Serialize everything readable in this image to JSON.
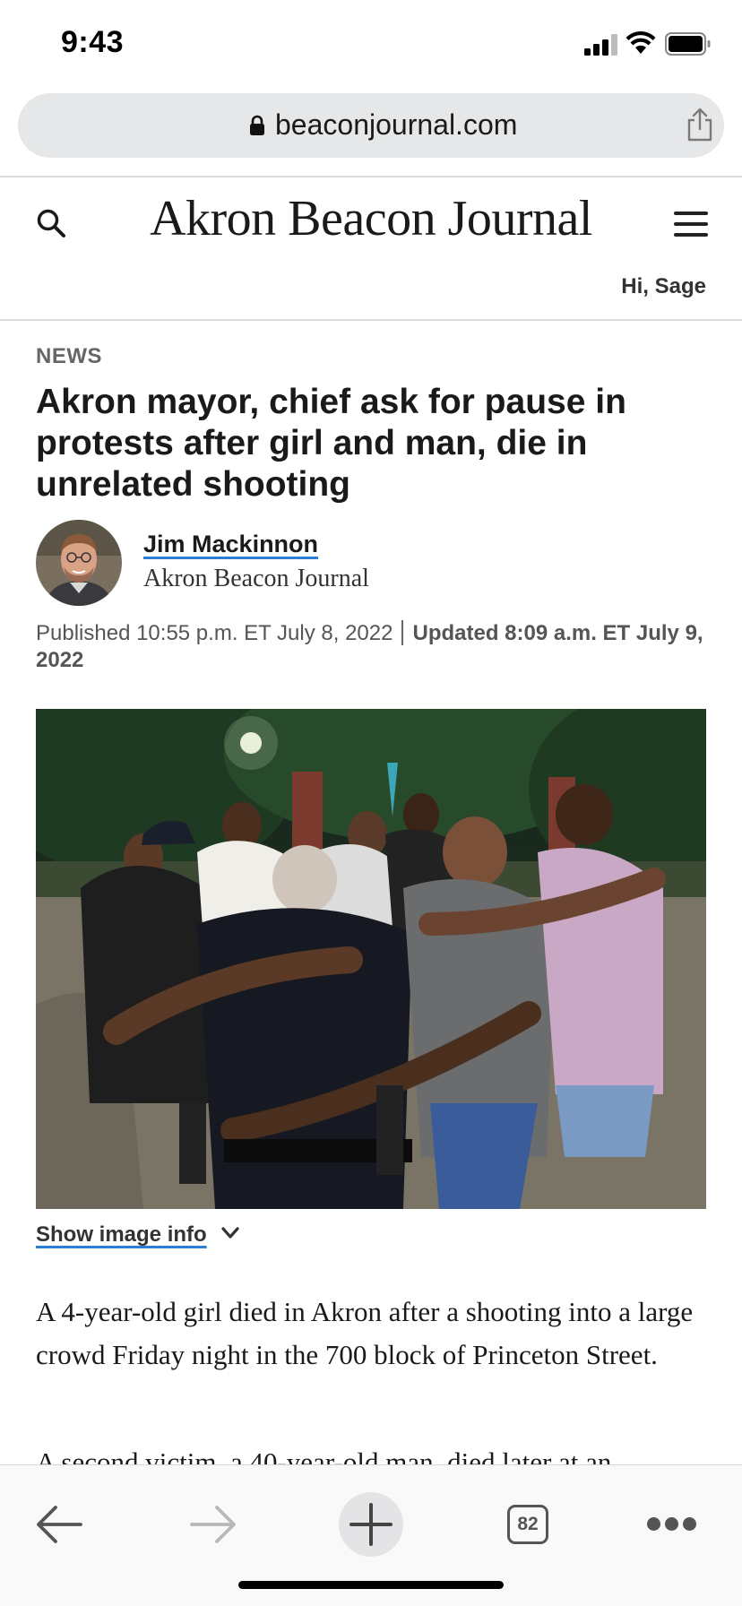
{
  "status_bar": {
    "time": "9:43"
  },
  "browser": {
    "url": "beaconjournal.com"
  },
  "site": {
    "logo": "Akron Beacon Journal",
    "greeting": "Hi, Sage"
  },
  "article": {
    "section": "NEWS",
    "headline": "Akron mayor, chief ask for pause in protests after girl and man, die in unrelated shooting",
    "author": {
      "name": "Jim Mackinnon",
      "outlet": "Akron Beacon Journal"
    },
    "published": "Published 10:55 p.m. ET July 8, 2022",
    "updated": "Updated 8:09 a.m. ET July 9, 2022",
    "image_info_label": "Show image info",
    "paragraphs": [
      "A 4-year-old girl died in Akron after a shooting into a large crowd Friday night in the 700 block of Princeton Street.",
      "A second victim, a 40-year-old man, died later at an"
    ]
  },
  "toolbar": {
    "tab_count": "82"
  },
  "icons": [
    "lock-icon",
    "share-icon",
    "search-icon",
    "menu-icon",
    "chevron-down-icon",
    "back-arrow-icon",
    "forward-arrow-icon",
    "plus-icon",
    "tabs-icon",
    "more-icon"
  ]
}
